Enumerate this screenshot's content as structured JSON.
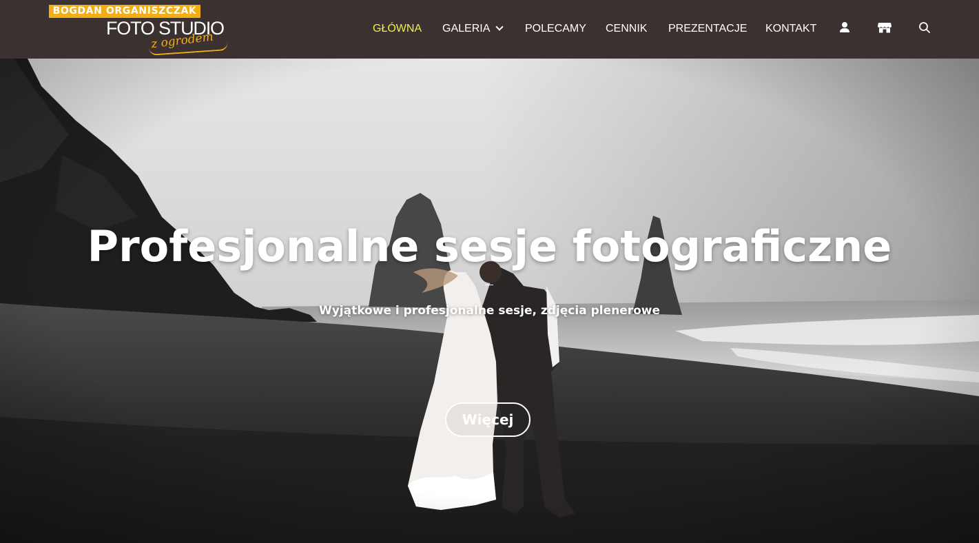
{
  "logo": {
    "banner": "BOGDAN ORGANISZCZAK",
    "main": "FOTO STUDIO",
    "sub": "z ogrodem"
  },
  "nav": {
    "items": [
      {
        "label": "GŁÓWNA",
        "active": true
      },
      {
        "label": "GALERIA",
        "has_dropdown": true
      },
      {
        "label": "POLECAMY"
      },
      {
        "label": "CENNIK"
      },
      {
        "label": "PREZENTACJE"
      },
      {
        "label": "KONTAKT"
      }
    ],
    "icons": [
      "user-icon",
      "store-icon",
      "search-icon"
    ]
  },
  "hero": {
    "title": "Profesjonalne sesje fotograficzne",
    "subtitle": "Wyjątkowe i profesjonalne sesje, zdjęcia plenerowe",
    "button_label": "Więcej"
  },
  "colors": {
    "header_bg": "#3b3131",
    "nav_active": "#eef146",
    "logo_accent": "#f2ae15",
    "text": "#ffffff"
  }
}
